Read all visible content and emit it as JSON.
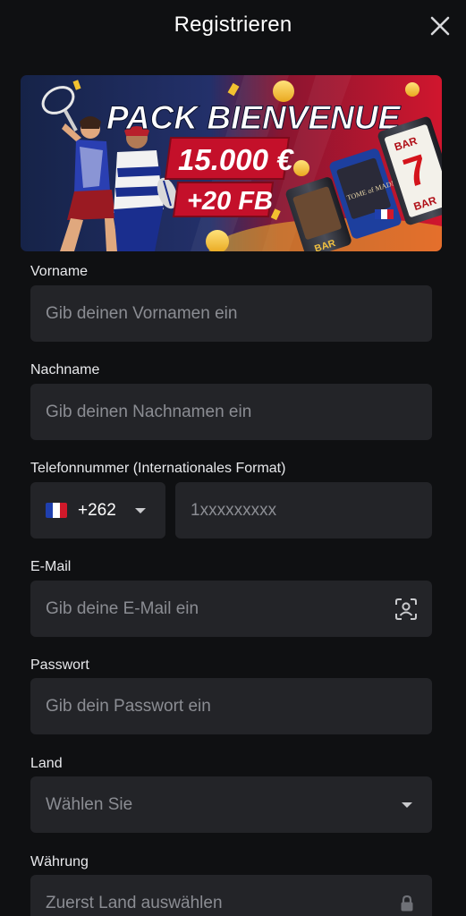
{
  "header": {
    "title": "Registrieren",
    "close_icon": "close-icon"
  },
  "banner": {
    "headline": "PACK BIENVENUE",
    "amount": "15.000 €",
    "bonus": "+20 FB",
    "reel_game_title": "TOME of MADNESS",
    "reel_symbol_label": "BAR",
    "colors": {
      "left_bg": "#1c2a52",
      "right_bg": "#c7152c",
      "gold": "#f2c230",
      "badge_red": "#c4102a"
    }
  },
  "form": {
    "first_name": {
      "label": "Vorname",
      "placeholder": "Gib deinen Vornamen ein"
    },
    "last_name": {
      "label": "Nachname",
      "placeholder": "Gib deinen Nachnamen ein"
    },
    "phone": {
      "label": "Telefonnummer (Internationales Format)",
      "country_code": "+262",
      "flag": "france-flag-icon",
      "placeholder": "1xxxxxxxxx"
    },
    "email": {
      "label": "E-Mail",
      "placeholder": "Gib deine E-Mail ein",
      "icon": "contact-scan-icon"
    },
    "password": {
      "label": "Passwort",
      "placeholder": "Gib dein Passwort ein"
    },
    "country": {
      "label": "Land",
      "placeholder": "Wählen Sie",
      "icon": "chevron-down-icon"
    },
    "currency": {
      "label": "Währung",
      "placeholder": "Zuerst Land auswählen",
      "icon": "lock-icon"
    }
  },
  "colors": {
    "background": "#0f1012",
    "input_bg": "#232428",
    "placeholder": "#8b8d93",
    "text": "#ffffff"
  }
}
